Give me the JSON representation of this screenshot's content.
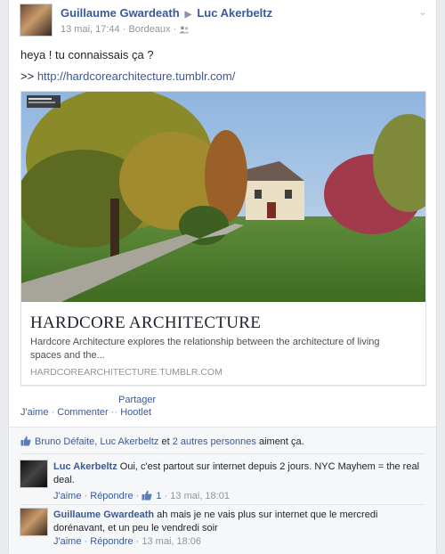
{
  "header": {
    "author": "Guillaume Gwardeath",
    "recipient": "Luc Akerbeltz",
    "time": "13 mai, 17:44",
    "separator": "·",
    "location": "Bordeaux",
    "audience_icon": "friends-icon",
    "menu_icon": "chevron-down-icon"
  },
  "post": {
    "text": "heya ! tu connaissais ça ?",
    "link_prefix": ">>",
    "link_url": "http://hardcorearchitecture.tumblr.com/"
  },
  "card": {
    "title": "HARDCORE ARCHITECTURE",
    "description": "Hardcore Architecture explores the relationship between the architecture of living spaces and the...",
    "domain": "HARDCOREARCHITECTURE.TUMBLR.COM",
    "image": "street-view-house-photo"
  },
  "actions": {
    "share_label": "Partager",
    "like": "J'aime",
    "comment": "Commenter",
    "dot": "·",
    "dot2": "·",
    "dot3": "·",
    "hootlet": "Hootlet"
  },
  "likes": {
    "names": "Bruno Défaite, Luc Akerbeltz",
    "and_word": "et",
    "others": "2 autres personnes",
    "suffix": "aiment ça."
  },
  "comments": [
    {
      "author": "Luc Akerbeltz",
      "text": "Oui, c'est partout sur internet depuis 2 jours. NYC Mayhem = the real deal.",
      "like": "J'aime",
      "sep1": "·",
      "reply": "Répondre",
      "sep2": "·",
      "like_count": "1",
      "sep3": "·",
      "time": "13 mai, 18:01"
    },
    {
      "author": "Guillaume Gwardeath",
      "text": "ah mais je ne vais plus sur internet que le mercredi dorénavant, et un peu le vendredi soir",
      "like": "J'aime",
      "sep1": "·",
      "reply": "Répondre",
      "sep2": "·",
      "time": "13 mai, 18:06"
    }
  ],
  "colors": {
    "link": "#3b5998",
    "text": "#1d2129",
    "muted": "#90949c",
    "background": "#e9ebee"
  }
}
